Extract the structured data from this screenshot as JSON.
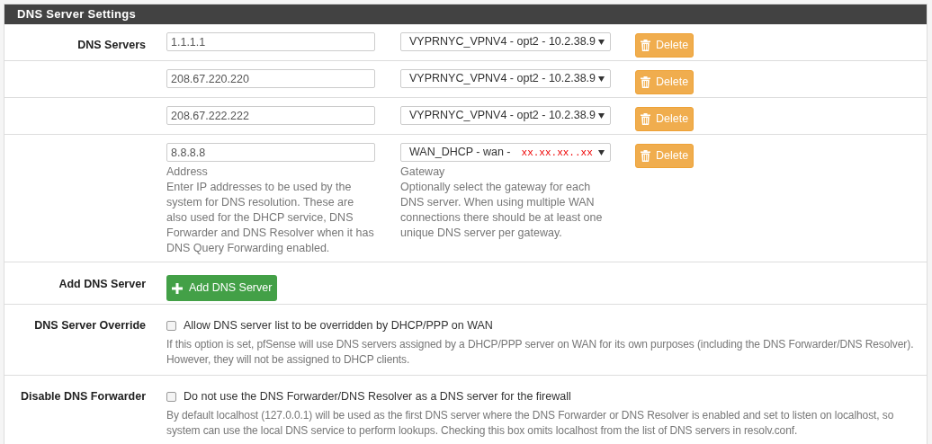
{
  "panel": {
    "title": "DNS Server Settings"
  },
  "dns_servers": {
    "label": "DNS Servers",
    "rows": [
      {
        "address": "1.1.1.1",
        "gateway": "VYPRNYC_VPNV4 - opt2 - 10.2.38.9",
        "delete": "Delete"
      },
      {
        "address": "208.67.220.220",
        "gateway": "VYPRNYC_VPNV4 - opt2 - 10.2.38.9",
        "delete": "Delete"
      },
      {
        "address": "208.67.222.222",
        "gateway": "VYPRNYC_VPNV4 - opt2 - 10.2.38.9",
        "delete": "Delete"
      },
      {
        "address": "8.8.8.8",
        "gateway": "WAN_DHCP - wan -",
        "gateway_redacted": "xx.xx.xx..xx",
        "delete": "Delete"
      }
    ],
    "address_label": "Address",
    "address_help": "Enter IP addresses to be used by the system for DNS resolution. These are also used for the DHCP service, DNS Forwarder and DNS Resolver when it has DNS Query Forwarding enabled.",
    "gateway_label": "Gateway",
    "gateway_help": "Optionally select the gateway for each DNS server. When using multiple WAN connections there should be at least one unique DNS server per gateway."
  },
  "add_server": {
    "label": "Add DNS Server",
    "button": "Add DNS Server"
  },
  "options": [
    {
      "label": "DNS Server Override",
      "checkbox_label": "Allow DNS server list to be overridden by DHCP/PPP on WAN",
      "checked": false,
      "help": "If this option is set, pfSense will use DNS servers assigned by a DHCP/PPP server on WAN for its own purposes (including the DNS Forwarder/DNS Resolver). However, they will not be assigned to DHCP clients."
    },
    {
      "label": "Disable DNS Forwarder",
      "checkbox_label": "Do not use the DNS Forwarder/DNS Resolver as a DNS server for the firewall",
      "checked": false,
      "help": "By default localhost (127.0.0.1) will be used as the first DNS server where the DNS Forwarder or DNS Resolver is enabled and set to listen on localhost, so system can use the local DNS service to perform lookups. Checking this box omits localhost from the list of DNS servers in resolv.conf."
    }
  ]
}
